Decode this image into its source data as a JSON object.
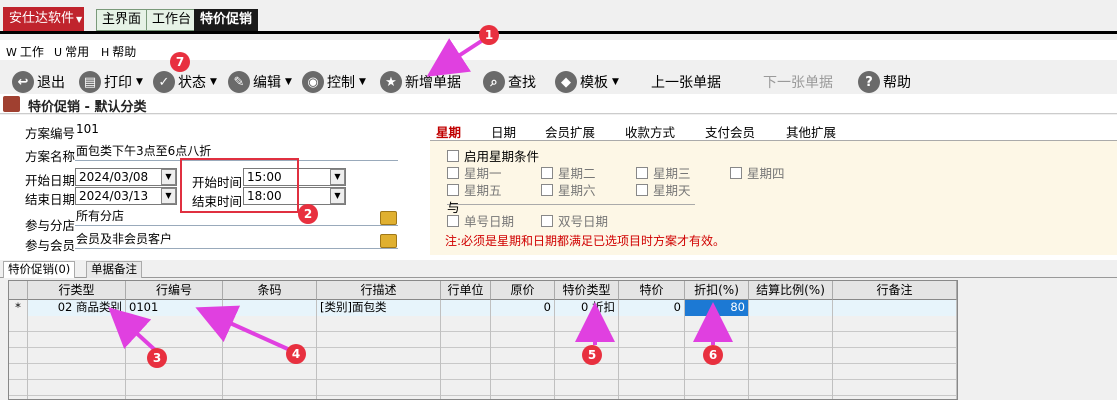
{
  "topbar": {
    "brand": "安仕达软件",
    "tabs": [
      {
        "label": "主界面"
      },
      {
        "label": "工作台"
      },
      {
        "label": "特价促销"
      }
    ]
  },
  "menubar": {
    "items": [
      {
        "key": "W",
        "label": "工作"
      },
      {
        "key": "U",
        "label": "常用"
      },
      {
        "key": "H",
        "label": "帮助"
      }
    ]
  },
  "toolbar": {
    "buttons": [
      {
        "label": "退出",
        "icon": "exit-icon"
      },
      {
        "label": "打印",
        "icon": "print-icon"
      },
      {
        "label": "状态",
        "icon": "status-icon"
      },
      {
        "label": "编辑",
        "icon": "edit-icon"
      },
      {
        "label": "控制",
        "icon": "control-icon"
      },
      {
        "label": "新增单据",
        "icon": "star-icon"
      },
      {
        "label": "查找",
        "icon": "search-icon"
      },
      {
        "label": "模板",
        "icon": "template-icon"
      },
      {
        "label": "上一张单据"
      },
      {
        "label": "下一张单据"
      },
      {
        "label": "帮助",
        "icon": "help-icon"
      }
    ]
  },
  "titlebar": {
    "title": "特价促销 - 默认分类"
  },
  "form": {
    "scheme_no_label": "方案编号",
    "scheme_no": "101",
    "scheme_name_label": "方案名称",
    "scheme_name": "面包类下午3点至6点八折",
    "start_date_label": "开始日期",
    "start_date": "2024/03/08",
    "end_date_label": "结束日期",
    "end_date": "2024/03/13",
    "start_time_label": "开始时间",
    "start_time": "15:00",
    "end_time_label": "结束时间",
    "end_time": "18:00",
    "branch_label": "参与分店",
    "branch": "所有分店",
    "member_label": "参与会员",
    "member": "会员及非会员客户"
  },
  "right_tabs": [
    {
      "label": "星期"
    },
    {
      "label": "日期"
    },
    {
      "label": "会员扩展"
    },
    {
      "label": "收款方式"
    },
    {
      "label": "支付会员"
    },
    {
      "label": "其他扩展"
    }
  ],
  "week_panel": {
    "enable_label": "启用星期条件",
    "days": [
      "星期一",
      "星期二",
      "星期三",
      "星期四",
      "星期五",
      "星期六",
      "星期天"
    ],
    "and_label": "与",
    "odd_label": "单号日期",
    "even_label": "双号日期",
    "notice": "注:必须是星期和日期都满足已选项目时方案才有效。"
  },
  "lower_tabs": [
    {
      "label": "特价促销(0)"
    },
    {
      "label": "单据备注"
    }
  ],
  "grid": {
    "columns": [
      "行类型",
      "行编号",
      "条码",
      "行描述",
      "行单位",
      "原价",
      "特价类型",
      "特价",
      "折扣(%)",
      "结算比例(%)",
      "行备注"
    ],
    "row_marker": "*",
    "row": {
      "type": "02 商品类别",
      "code": "0101",
      "barcode": "",
      "desc": "[类别]面包类",
      "unit": "",
      "orig_price": "0",
      "special_type": "0 折扣",
      "special_price": "0",
      "discount": "80",
      "settle": "",
      "remark": ""
    }
  },
  "callouts": [
    "1",
    "2",
    "3",
    "4",
    "5",
    "6",
    "7"
  ],
  "colors": {
    "accent": "#c0242d",
    "callout": "#e8303f",
    "arrow": "#e040e0",
    "selection": "#1c79d4"
  }
}
